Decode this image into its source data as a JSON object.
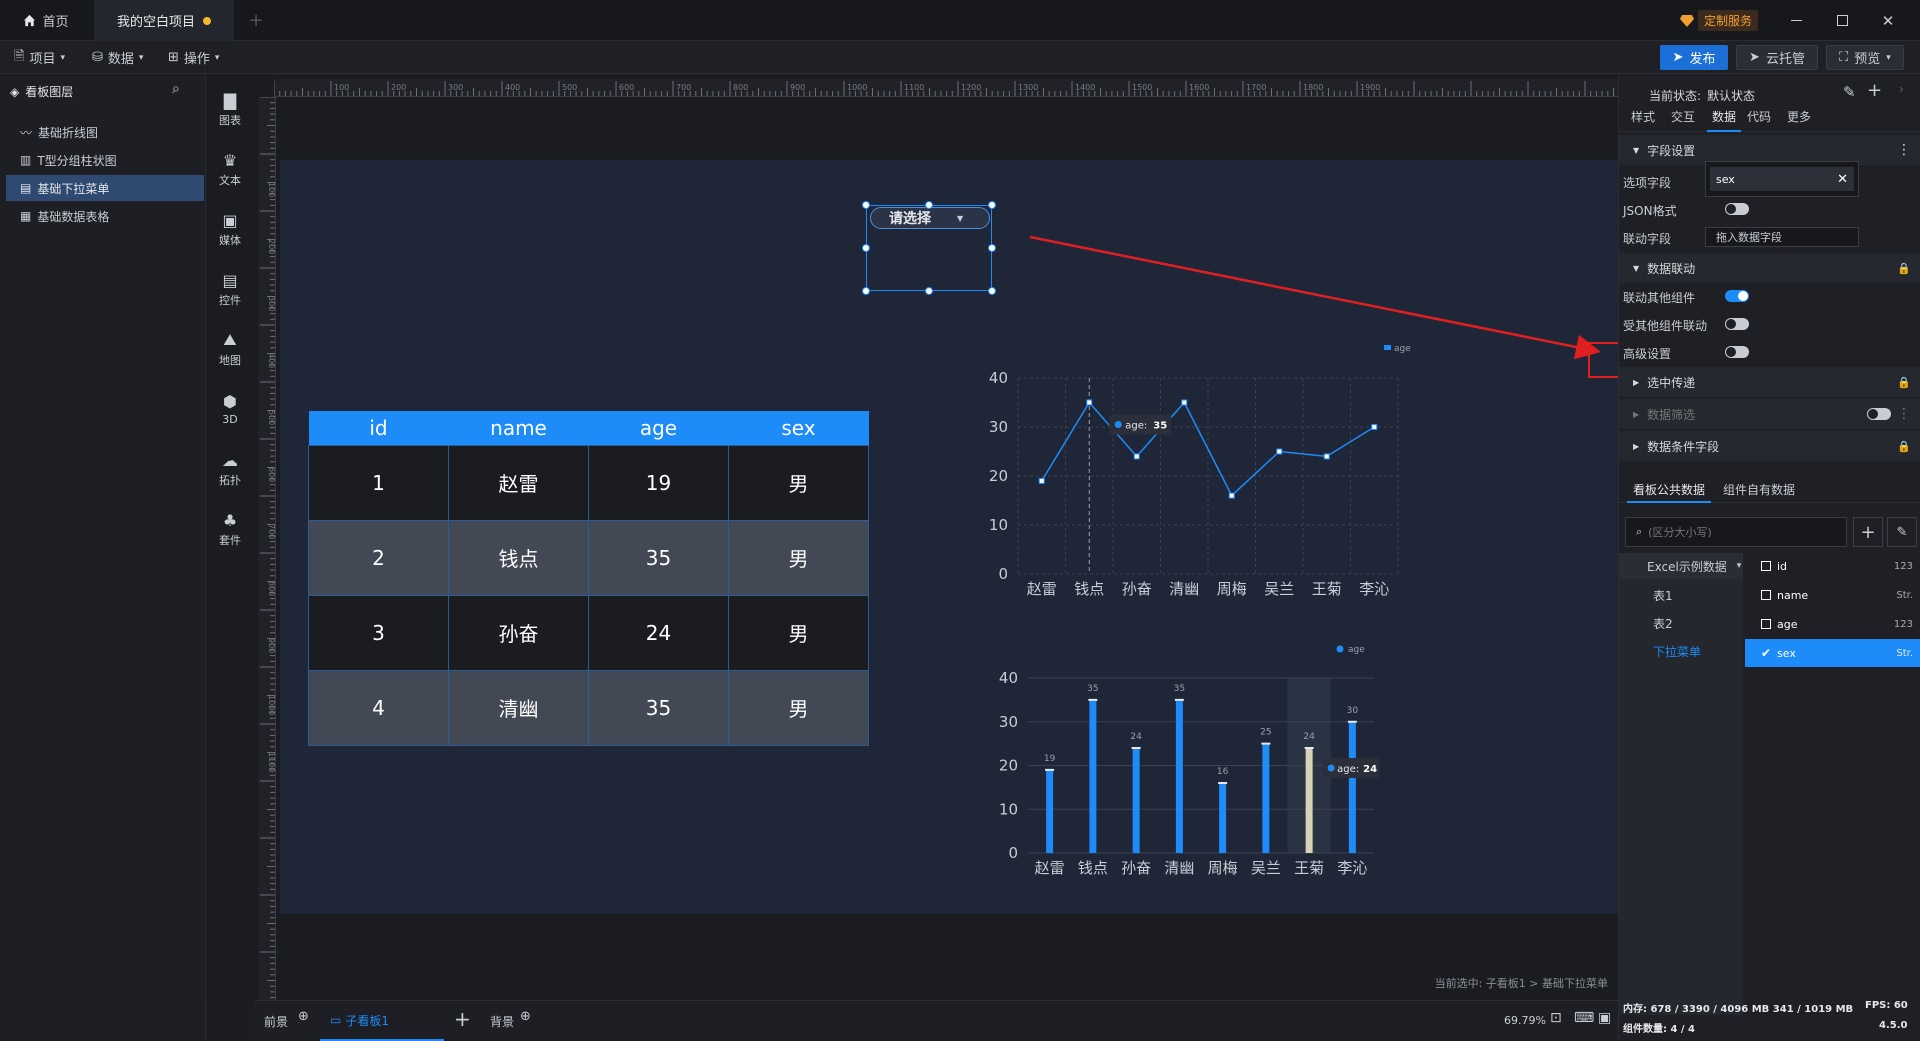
{
  "titlebar": {
    "home_tab": "首页",
    "project_tab": "我的空白项目",
    "custom_service": "定制服务"
  },
  "menubar": {
    "project": "项目",
    "data": "数据",
    "operation": "操作",
    "publish": "发布",
    "cloud_hosting": "云托管",
    "preview": "预览"
  },
  "layers": {
    "title": "看板图层",
    "items": [
      {
        "label": "基础折线图",
        "icon": "line-chart-icon"
      },
      {
        "label": "T型分组柱状图",
        "icon": "bar-chart-icon"
      },
      {
        "label": "基础下拉菜单",
        "icon": "dropdown-icon"
      },
      {
        "label": "基础数据表格",
        "icon": "table-icon"
      }
    ]
  },
  "toolbox": {
    "items": [
      "图表",
      "文本",
      "媒体",
      "控件",
      "地图",
      "3D",
      "拓扑",
      "套件"
    ]
  },
  "ruler": {
    "h_ticks": [
      "100",
      "200",
      "300",
      "400",
      "500",
      "600",
      "700",
      "800",
      "900",
      "1000",
      "1100",
      "1200",
      "1300",
      "1400",
      "1500",
      "1600",
      "1700",
      "1800",
      "1900"
    ],
    "v_ticks": [
      "100",
      "200",
      "300",
      "400",
      "500",
      "600",
      "700",
      "800",
      "900",
      "1000",
      "1100"
    ]
  },
  "dropdown": {
    "placeholder": "请选择"
  },
  "table": {
    "headers": [
      "id",
      "name",
      "age",
      "sex"
    ],
    "rows": [
      [
        "1",
        "赵雷",
        "19",
        "男"
      ],
      [
        "2",
        "钱点",
        "35",
        "男"
      ],
      [
        "3",
        "孙奋",
        "24",
        "男"
      ],
      [
        "4",
        "清幽",
        "35",
        "男"
      ]
    ]
  },
  "chart_data": [
    {
      "type": "line",
      "categories": [
        "赵雷",
        "钱点",
        "孙奋",
        "清幽",
        "周梅",
        "吴兰",
        "王菊",
        "李沁"
      ],
      "series": [
        {
          "name": "age",
          "values": [
            19,
            35,
            24,
            35,
            16,
            25,
            24,
            30
          ]
        }
      ],
      "ylim": [
        0,
        40
      ],
      "yticks": [
        "0",
        "10",
        "20",
        "30",
        "40"
      ],
      "grid": true,
      "legend": "top-right",
      "tooltip": {
        "label": "age:",
        "value": "35"
      }
    },
    {
      "type": "bar",
      "categories": [
        "赵雷",
        "钱点",
        "孙奋",
        "清幽",
        "周梅",
        "吴兰",
        "王菊",
        "李沁"
      ],
      "series": [
        {
          "name": "age",
          "values": [
            19,
            35,
            24,
            35,
            16,
            25,
            24,
            30
          ]
        }
      ],
      "data_labels": [
        "19",
        "35",
        "24",
        "35",
        "16",
        "25",
        "24",
        "30"
      ],
      "ylim": [
        0,
        40
      ],
      "yticks": [
        "0",
        "10",
        "20",
        "30",
        "40"
      ],
      "grid": true,
      "legend": "top-right",
      "highlight_index": 6,
      "tooltip": {
        "label": "age:",
        "value": "24"
      }
    }
  ],
  "colors": {
    "accent": "#1d8cf8",
    "highlight_bar": "#d8d2b8",
    "annotation": "#e02020"
  },
  "canvas": {
    "selection_status": "当前选中: 子看板1 > 基础下拉菜单"
  },
  "bottombar": {
    "foreground": "前景",
    "subboard": "子看板1",
    "background": "背景",
    "zoom": "69.79%"
  },
  "rpanel": {
    "state_label": "当前状态:",
    "state_value": "默认状态",
    "tabs": [
      "样式",
      "交互",
      "数据",
      "代码",
      "更多"
    ],
    "active_tab": 2,
    "section_fields": "字段设置",
    "option_field_label": "选项字段",
    "option_field_value": "sex",
    "json_label": "JSON格式",
    "link_field_label": "联动字段",
    "link_field_placeholder": "拖入数据字段",
    "section_linkage": "数据联动",
    "link_others": "联动其他组件",
    "linked_by_others": "受其他组件联动",
    "advanced": "高级设置",
    "section_pass": "选中传递",
    "section_filter": "数据筛选",
    "section_condition": "数据条件字段",
    "datatab_public": "看板公共数据",
    "datatab_own": "组件自有数据",
    "search_placeholder": "(区分大小写)",
    "source_group": "Excel示例数据",
    "sources": [
      "表1",
      "表2",
      "下拉菜单"
    ],
    "fields": [
      {
        "name": "id",
        "type": "123",
        "checked": false
      },
      {
        "name": "name",
        "type": "Str.",
        "checked": false
      },
      {
        "name": "age",
        "type": "123",
        "checked": false
      },
      {
        "name": "sex",
        "type": "Str.",
        "checked": true
      }
    ]
  },
  "statusbar": {
    "memory": "内存: 678 / 3390 / 4096 MB 341 / 1019 MB",
    "fps": "FPS: 60",
    "components": "组件数量: 4 / 4",
    "version": "4.5.0"
  }
}
